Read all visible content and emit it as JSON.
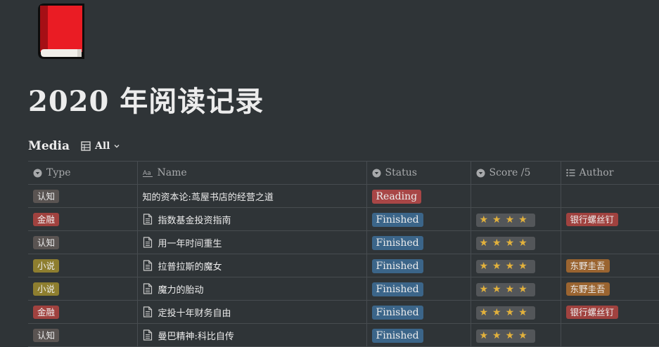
{
  "page": {
    "icon": "red-book-icon",
    "title": "2020 年阅读记录"
  },
  "database": {
    "title": "Media",
    "view": {
      "icon": "table-icon",
      "label": "All"
    }
  },
  "columns": [
    {
      "label": "Type",
      "icon": "select-property-icon"
    },
    {
      "label": "Name",
      "icon": "title-property-icon"
    },
    {
      "label": "Status",
      "icon": "select-property-icon"
    },
    {
      "label": "Score /5",
      "icon": "select-property-icon"
    },
    {
      "label": "Author",
      "icon": "multi-select-property-icon"
    }
  ],
  "rows": [
    {
      "type": "认知",
      "type_color": "gray",
      "name": "知的资本论:茑屋书店的经营之道",
      "has_page_icon": false,
      "status": "Reading",
      "score": "",
      "author": "",
      "author_color": ""
    },
    {
      "type": "金融",
      "type_color": "red",
      "name": "指数基金投资指南",
      "has_page_icon": true,
      "status": "Finished",
      "score": "★★★★",
      "author": "银行螺丝钉",
      "author_color": "red"
    },
    {
      "type": "认知",
      "type_color": "gray",
      "name": "用一年时间重生",
      "has_page_icon": true,
      "status": "Finished",
      "score": "★★★★",
      "author": "",
      "author_color": ""
    },
    {
      "type": "小说",
      "type_color": "yellow",
      "name": "拉普拉斯的魔女",
      "has_page_icon": true,
      "status": "Finished",
      "score": "★★★★",
      "author": "东野圭吾",
      "author_color": "orange"
    },
    {
      "type": "小说",
      "type_color": "yellow",
      "name": "魔力的胎动",
      "has_page_icon": true,
      "status": "Finished",
      "score": "★★★★",
      "author": "东野圭吾",
      "author_color": "orange"
    },
    {
      "type": "金融",
      "type_color": "red",
      "name": "定投十年财务自由",
      "has_page_icon": true,
      "status": "Finished",
      "score": "★★★★",
      "author": "银行螺丝钉",
      "author_color": "red"
    },
    {
      "type": "认知",
      "type_color": "gray",
      "name": "曼巴精神:科比自传",
      "has_page_icon": true,
      "status": "Finished",
      "score": "★★★★",
      "author": "",
      "author_color": ""
    }
  ],
  "colors": {
    "background": "#2f3437",
    "tag_gray": "#5a5452",
    "tag_red": "#a0423f",
    "tag_yellow": "#8e7e2f",
    "tag_orange": "#9a6430",
    "status_reading": "#a84646",
    "status_finished": "#3b6589",
    "star": "#e2b13c"
  }
}
